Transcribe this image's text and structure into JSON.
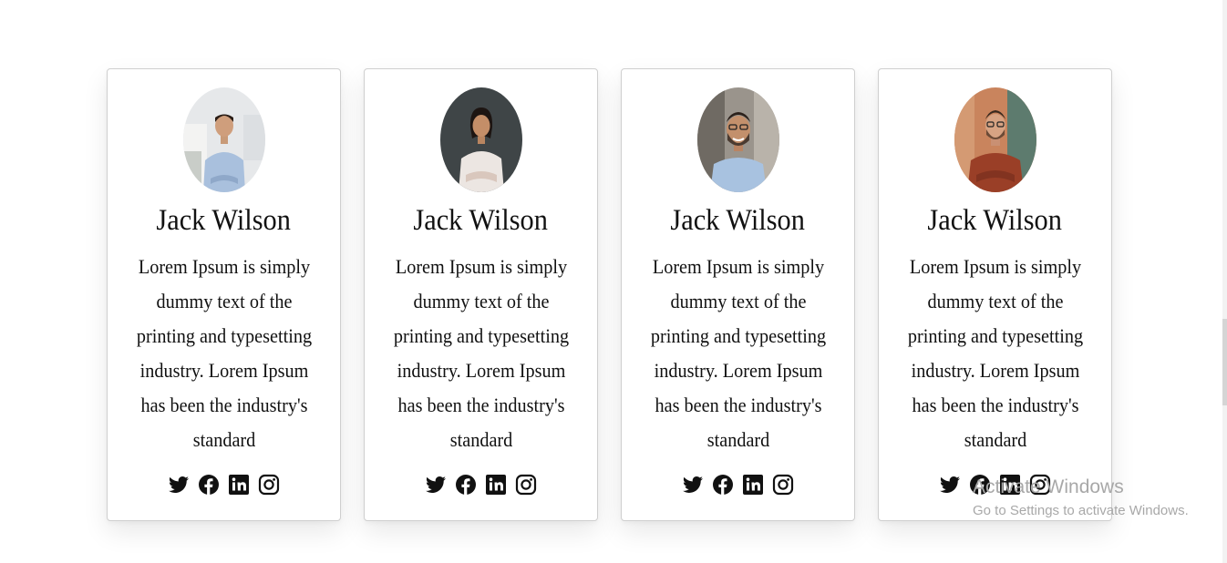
{
  "cards": [
    {
      "name": "Jack Wilson",
      "description": "Lorem Ipsum is simply dummy text of the printing and typesetting industry. Lorem Ipsum has been the industry's standard",
      "photo": "man-smiling-arms-crossed-office"
    },
    {
      "name": "Jack Wilson",
      "description": "Lorem Ipsum is simply dummy text of the printing and typesetting industry. Lorem Ipsum has been the industry's standard",
      "photo": "woman-smiling-arms-crossed-dark-background"
    },
    {
      "name": "Jack Wilson",
      "description": "Lorem Ipsum is simply dummy text of the printing and typesetting industry. Lorem Ipsum has been the industry's standard",
      "photo": "bearded-man-glasses-smiling"
    },
    {
      "name": "Jack Wilson",
      "description": "Lorem Ipsum is simply dummy text of the printing and typesetting industry. Lorem Ipsum has been the industry's standard",
      "photo": "man-glasses-red-sweater"
    }
  ],
  "social_icons": [
    "twitter-icon",
    "facebook-icon",
    "linkedin-icon",
    "instagram-icon"
  ],
  "watermark": {
    "title": "Activate Windows",
    "subtitle": "Go to Settings to activate Windows."
  },
  "colors": {
    "text": "#111111",
    "card_border": "#cfcfcf",
    "watermark": "#a8a8a8"
  }
}
